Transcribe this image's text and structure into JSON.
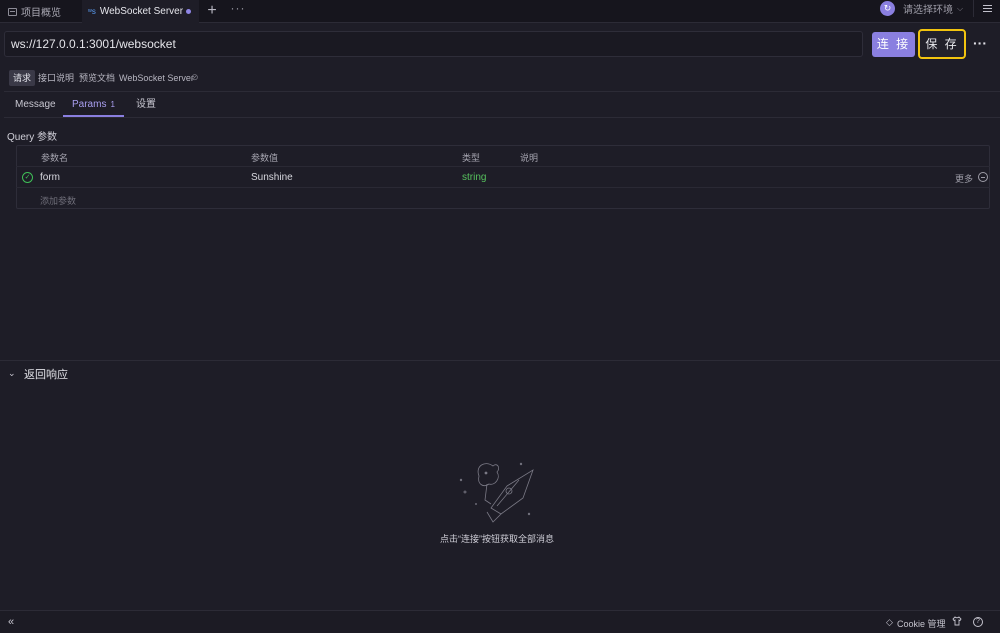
{
  "tabs": {
    "overview_label": "项目概览",
    "active_label": "WebSocket Server",
    "add_label": "+",
    "more_label": "···"
  },
  "env": {
    "icon_glyph": "↻",
    "select_label": "请选择环境",
    "chevron": "⌵"
  },
  "request": {
    "url": "ws://127.0.0.1:3001/websocket",
    "connect_label": "连 接",
    "save_label": "保 存",
    "more_label": "···"
  },
  "subtabs": {
    "request_label": "请求",
    "doc_label": "接口说明",
    "preview_label": "预览文档",
    "api_name": "WebSocket Server",
    "link_glyph": "🔗"
  },
  "param_tabs": {
    "message_label": "Message",
    "params_label": "Params",
    "params_count": "1",
    "settings_label": "设置"
  },
  "params": {
    "section_title": "Query 参数",
    "columns": [
      "参数名",
      "参数值",
      "类型",
      "说明"
    ],
    "rows": [
      {
        "name": "form",
        "value": "Sunshine",
        "type": "string",
        "description": "",
        "enabled": true
      }
    ],
    "row_more_label": "更多",
    "add_placeholder": "添加参数"
  },
  "response": {
    "title": "返回响应",
    "empty_text": "点击“连接”按钮获取全部消息"
  },
  "footer": {
    "collapse_glyph": "«",
    "cookie_label": "Cookie 管理",
    "help_glyph": "?"
  },
  "colors": {
    "accent": "#8a7fe0",
    "highlight": "#f2c40f",
    "success": "#3fbf57",
    "background": "#1e1d27"
  },
  "icons": [
    "overview-icon",
    "websocket-icon",
    "unsaved-dot-icon",
    "env-icon",
    "menu-icon",
    "link-icon",
    "check-icon",
    "remove-icon",
    "chevron-down-icon",
    "rocket-illustration",
    "collapse-icon",
    "cookie-icon",
    "shirt-icon",
    "help-icon"
  ]
}
